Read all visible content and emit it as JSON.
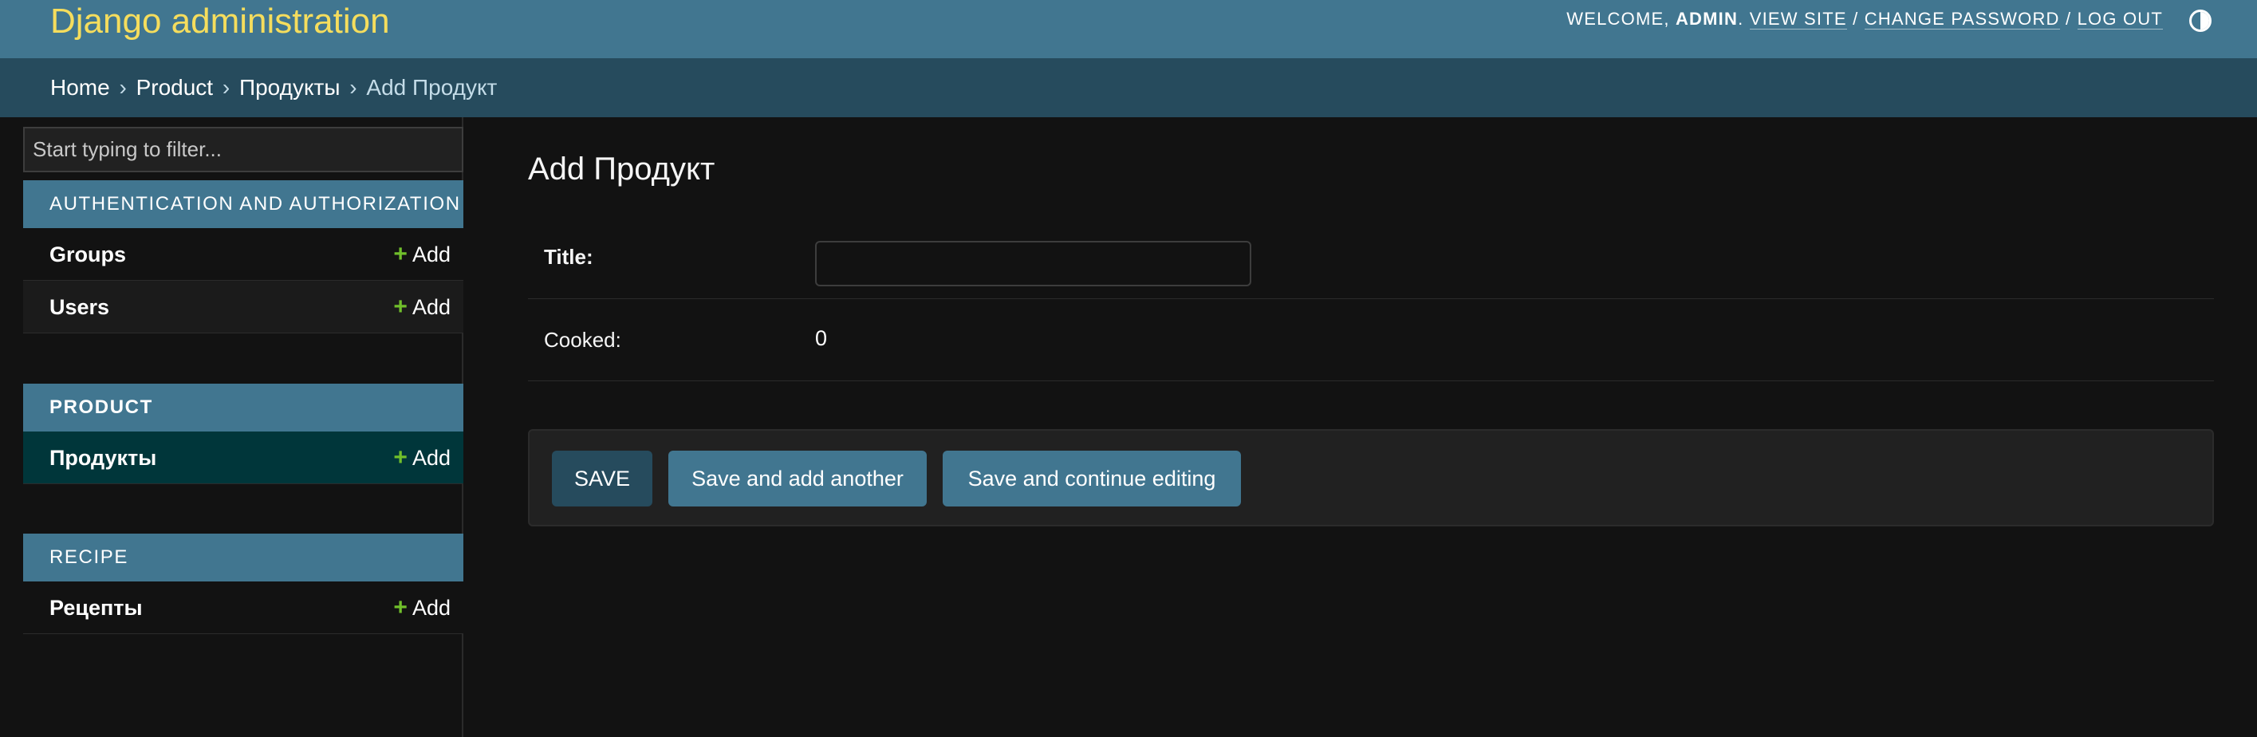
{
  "header": {
    "brand": "Django administration",
    "welcome_prefix": "WELCOME,",
    "username": "ADMIN",
    "welcome_suffix": ".",
    "view_site": "VIEW SITE",
    "change_password": "CHANGE PASSWORD",
    "log_out": "LOG OUT",
    "separator": "/",
    "theme_icon": "theme-toggle-icon"
  },
  "breadcrumbs": {
    "items": [
      "Home",
      "Product",
      "Продукты",
      "Add Продукт"
    ],
    "separator": "›"
  },
  "sidebar": {
    "filter_placeholder": "Start typing to filter...",
    "add_label": "Add",
    "add_icon": "plus-icon",
    "modules": [
      {
        "caption": "AUTHENTICATION AND AUTHORIZATION",
        "rows": [
          "Groups",
          "Users"
        ]
      },
      {
        "caption": "PRODUCT",
        "rows": [
          "Продукты"
        ]
      },
      {
        "caption": "RECIPE",
        "rows": [
          "Рецепты"
        ]
      }
    ]
  },
  "main": {
    "title": "Add Продукт",
    "fields": [
      {
        "label": "Title:",
        "value": ""
      },
      {
        "label": "Cooked:",
        "value": "0"
      }
    ],
    "buttons": {
      "save": "SAVE",
      "save_add_another": "Save and add another",
      "save_continue": "Save and continue editing"
    }
  },
  "colors": {
    "header_bg": "#417690",
    "breadcrumb_bg": "#264b5d",
    "brand": "#f5dd5d",
    "page_bg": "#121212",
    "selected_row_bg": "#00363a",
    "add_icon": "#70bf2b"
  }
}
